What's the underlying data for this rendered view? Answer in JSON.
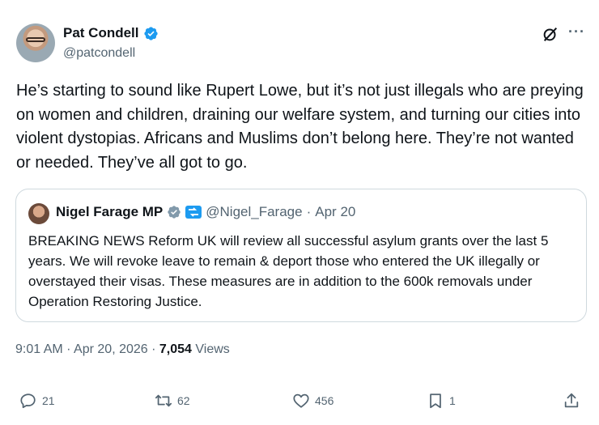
{
  "author": {
    "name": "Pat Condell",
    "handle": "@patcondell"
  },
  "tweet": {
    "text": "He’s starting to sound like Rupert Lowe, but it’s not just illegals who are preying on women and children, draining our welfare system, and turning our cities into violent dystopias. Africans and Muslims don’t belong here. They’re not wanted or needed. They’ve all got to go."
  },
  "quoted": {
    "name": "Nigel Farage MP",
    "handle": "@Nigel_Farage",
    "separator": "·",
    "date": "Apr 20",
    "text": "BREAKING NEWS Reform UK will review all successful asylum grants over the last 5 years. We will revoke leave to remain & deport those who entered the UK illegally or overstayed their visas. These measures are in addition to the 600k removals under Operation Restoring Justice."
  },
  "meta": {
    "time": "9:01 AM",
    "separator": "·",
    "date": "Apr 20, 2026",
    "views_count": "7,054",
    "views_label": "Views"
  },
  "actions": {
    "replies": "21",
    "reposts": "62",
    "likes": "456",
    "bookmarks": "1"
  },
  "icons": [
    "verified-badge-icon",
    "grok-icon",
    "more-icon",
    "affiliate-badge-icon",
    "reply-icon",
    "repost-icon",
    "like-icon",
    "bookmark-icon",
    "share-icon"
  ],
  "colors": {
    "accent": "#1d9bf0",
    "text": "#0f1419",
    "secondary": "#536471",
    "border": "#cfd9de"
  }
}
